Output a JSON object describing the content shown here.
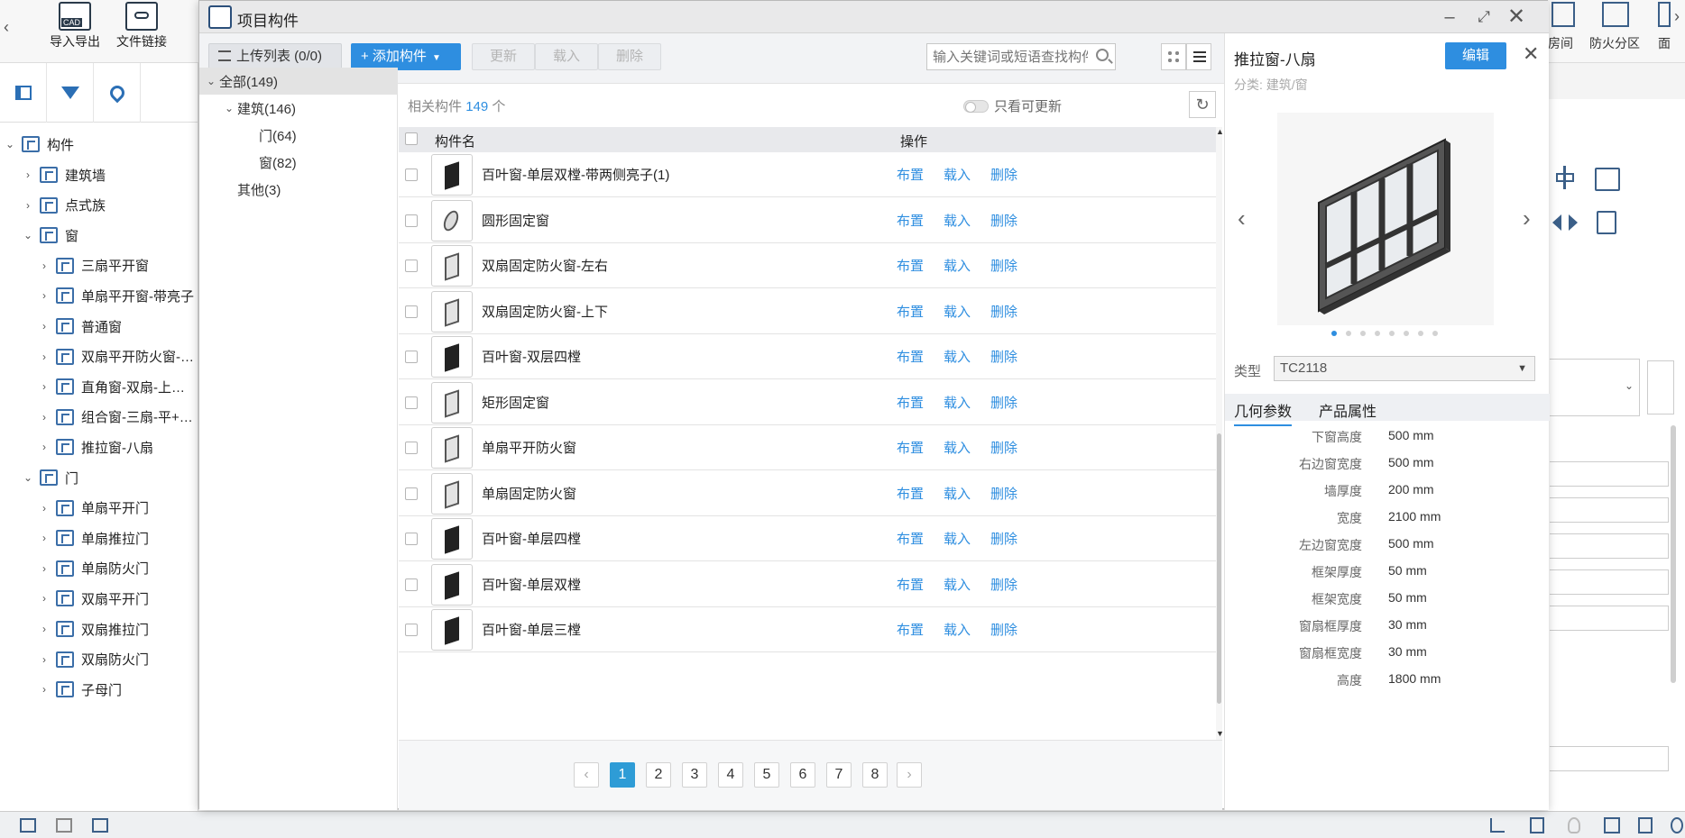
{
  "ribbon": {
    "import_export": "导入导出",
    "file_link": "文件链接",
    "right_room": "房间",
    "right_fire": "防火分区",
    "right_face": "面"
  },
  "left_tree": {
    "root": "构件",
    "items": [
      {
        "label": "建筑墙",
        "level": 1,
        "expanded": false
      },
      {
        "label": "点式族",
        "level": 1,
        "expanded": false
      },
      {
        "label": "窗",
        "level": 1,
        "expanded": true
      },
      {
        "label": "三扇平开窗",
        "level": 2,
        "expanded": false
      },
      {
        "label": "单扇平开窗-带亮子",
        "level": 2,
        "expanded": false
      },
      {
        "label": "普通窗",
        "level": 2,
        "expanded": false
      },
      {
        "label": "双扇平开防火窗-…",
        "level": 2,
        "expanded": false
      },
      {
        "label": "直角窗-双扇-上…",
        "level": 2,
        "expanded": false
      },
      {
        "label": "组合窗-三扇-平+…",
        "level": 2,
        "expanded": false
      },
      {
        "label": "推拉窗-八扇",
        "level": 2,
        "expanded": false
      },
      {
        "label": "门",
        "level": 1,
        "expanded": true
      },
      {
        "label": "单扇平开门",
        "level": 2,
        "expanded": false
      },
      {
        "label": "单扇推拉门",
        "level": 2,
        "expanded": false
      },
      {
        "label": "单扇防火门",
        "level": 2,
        "expanded": false
      },
      {
        "label": "双扇平开门",
        "level": 2,
        "expanded": false
      },
      {
        "label": "双扇推拉门",
        "level": 2,
        "expanded": false
      },
      {
        "label": "双扇防火门",
        "level": 2,
        "expanded": false
      },
      {
        "label": "子母门",
        "level": 2,
        "expanded": false
      }
    ]
  },
  "dialog": {
    "title": "项目构件",
    "toolbar": {
      "upload_list": "上传列表 (0/0)",
      "add_component": "+ 添加构件",
      "update": "更新",
      "load": "载入",
      "delete": "删除",
      "search_placeholder": "输入关键词或短语查找构件"
    },
    "categories": [
      {
        "label": "全部(149)",
        "indent": 0,
        "selected": true,
        "caret": "⌄"
      },
      {
        "label": "建筑(146)",
        "indent": 1,
        "selected": false,
        "caret": "⌄"
      },
      {
        "label": "门(64)",
        "indent": 2,
        "selected": false,
        "caret": ""
      },
      {
        "label": "窗(82)",
        "indent": 2,
        "selected": false,
        "caret": ""
      },
      {
        "label": "其他(3)",
        "indent": 1,
        "selected": false,
        "caret": ""
      }
    ],
    "list": {
      "count_prefix": "相关构件",
      "count": "149",
      "count_suffix": "个",
      "only_updatable": "只看可更新",
      "col_name": "构件名",
      "col_ops": "操作",
      "op_place": "布置",
      "op_load": "载入",
      "op_delete": "删除",
      "rows": [
        {
          "name": "百叶窗-单层双樘-带两侧亮子(1)",
          "thumb": "dark"
        },
        {
          "name": "圆形固定窗",
          "thumb": "oval"
        },
        {
          "name": "双扇固定防火窗-左右",
          "thumb": "light"
        },
        {
          "name": "双扇固定防火窗-上下",
          "thumb": "light"
        },
        {
          "name": "百叶窗-双层四樘",
          "thumb": "dark"
        },
        {
          "name": "矩形固定窗",
          "thumb": "light"
        },
        {
          "name": "单扇平开防火窗",
          "thumb": "light"
        },
        {
          "name": "单扇固定防火窗",
          "thumb": "light"
        },
        {
          "name": "百叶窗-单层四樘",
          "thumb": "dark"
        },
        {
          "name": "百叶窗-单层双樘",
          "thumb": "dark"
        },
        {
          "name": "百叶窗-单层三樘",
          "thumb": "dark"
        }
      ]
    },
    "pager": {
      "pages": [
        "1",
        "2",
        "3",
        "4",
        "5",
        "6",
        "7",
        "8"
      ],
      "current": "1",
      "prev": "‹",
      "next": "›"
    }
  },
  "detail": {
    "title": "推拉窗-八扇",
    "edit": "编辑",
    "category": "分类: 建筑/窗",
    "type_label": "类型",
    "type_value": "TC2118",
    "tab_geometry": "几何参数",
    "tab_product": "产品属性",
    "slide_count": "8",
    "slide_current": "1",
    "params": [
      {
        "key": "下窗高度",
        "value": "500 mm"
      },
      {
        "key": "右边窗宽度",
        "value": "500 mm"
      },
      {
        "key": "墙厚度",
        "value": "200 mm"
      },
      {
        "key": "宽度",
        "value": "2100 mm"
      },
      {
        "key": "左边窗宽度",
        "value": "500 mm"
      },
      {
        "key": "框架厚度",
        "value": "50 mm"
      },
      {
        "key": "框架宽度",
        "value": "50 mm"
      },
      {
        "key": "窗扇框厚度",
        "value": "30 mm"
      },
      {
        "key": "窗扇框宽度",
        "value": "30 mm"
      },
      {
        "key": "高度",
        "value": "1800 mm"
      }
    ]
  },
  "colors": {
    "accent": "#2e8ee0",
    "page_active": "#2e9cd6"
  }
}
